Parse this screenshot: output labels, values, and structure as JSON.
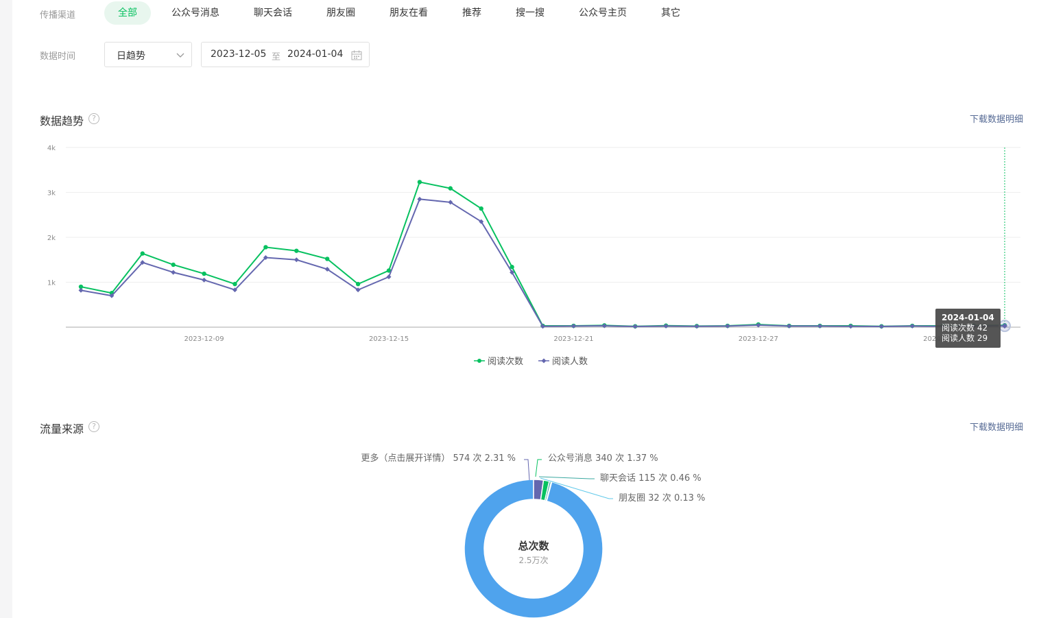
{
  "filters": {
    "channel_label": "传播渠道",
    "channel_tabs": [
      {
        "label": "全部",
        "active": true
      },
      {
        "label": "公众号消息"
      },
      {
        "label": "聊天会话"
      },
      {
        "label": "朋友圈"
      },
      {
        "label": "朋友在看"
      },
      {
        "label": "推荐"
      },
      {
        "label": "搜一搜"
      },
      {
        "label": "公众号主页"
      },
      {
        "label": "其它"
      }
    ],
    "time_label": "数据时间",
    "granularity_value": "日趋势",
    "date_start": "2023-12-05",
    "date_sep": "至",
    "date_end": "2024-01-04"
  },
  "trend": {
    "title": "数据趋势",
    "help": "?",
    "download": "下载数据明细",
    "tooltip": {
      "date": "2024-01-04",
      "line1": "阅读次数 42",
      "line2": "阅读人数 29"
    }
  },
  "traffic": {
    "title": "流量来源",
    "help": "?",
    "download": "下载数据明细",
    "center_title": "总次数",
    "center_value": "2.5万次",
    "labels": [
      "更多（点击展开详情） 574 次 2.31 %",
      "公众号消息 340 次 1.37 %",
      "聊天会话 115 次 0.46 %",
      "朋友圈 32 次 0.13 %"
    ]
  },
  "chart_data": [
    {
      "type": "line",
      "x": [
        "2023-12-05",
        "2023-12-06",
        "2023-12-07",
        "2023-12-08",
        "2023-12-09",
        "2023-12-10",
        "2023-12-11",
        "2023-12-12",
        "2023-12-13",
        "2023-12-14",
        "2023-12-15",
        "2023-12-16",
        "2023-12-17",
        "2023-12-18",
        "2023-12-19",
        "2023-12-20",
        "2023-12-21",
        "2023-12-22",
        "2023-12-23",
        "2023-12-24",
        "2023-12-25",
        "2023-12-26",
        "2023-12-27",
        "2023-12-28",
        "2023-12-29",
        "2023-12-30",
        "2023-12-31",
        "2024-01-01",
        "2024-01-02",
        "2024-01-03",
        "2024-01-04"
      ],
      "x_tick_labels": [
        "2023-12-09",
        "2023-12-15",
        "2023-12-21",
        "2023-12-27",
        "2024-01-02"
      ],
      "y_tick_labels": [
        "1k",
        "2k",
        "3k",
        "4k"
      ],
      "ylim": [
        0,
        4000
      ],
      "legend_position": "bottom-center",
      "series": [
        {
          "name": "阅读次数",
          "color": "#07c160",
          "values": [
            900,
            760,
            1640,
            1390,
            1190,
            960,
            1780,
            1700,
            1520,
            960,
            1260,
            3230,
            3090,
            2640,
            1340,
            30,
            30,
            40,
            20,
            35,
            25,
            30,
            60,
            30,
            30,
            30,
            20,
            30,
            30,
            35,
            42
          ]
        },
        {
          "name": "阅读人数",
          "color": "#6467af",
          "values": [
            820,
            700,
            1440,
            1220,
            1050,
            830,
            1550,
            1500,
            1290,
            830,
            1120,
            2850,
            2780,
            2350,
            1220,
            20,
            25,
            30,
            15,
            25,
            20,
            25,
            45,
            25,
            25,
            20,
            15,
            25,
            20,
            25,
            29
          ]
        }
      ]
    },
    {
      "type": "pie",
      "labels": [
        "其它",
        "更多（点击展开详情）",
        "公众号消息",
        "聊天会话",
        "朋友圈"
      ],
      "values": [
        23939,
        574,
        340,
        115,
        32
      ],
      "percentages": [
        95.73,
        2.31,
        1.37,
        0.46,
        0.13
      ],
      "colors": [
        "#4fa3ed",
        "#6467af",
        "#07c160",
        "#3aa8a0",
        "#5ec8ea"
      ],
      "donut": true
    }
  ]
}
